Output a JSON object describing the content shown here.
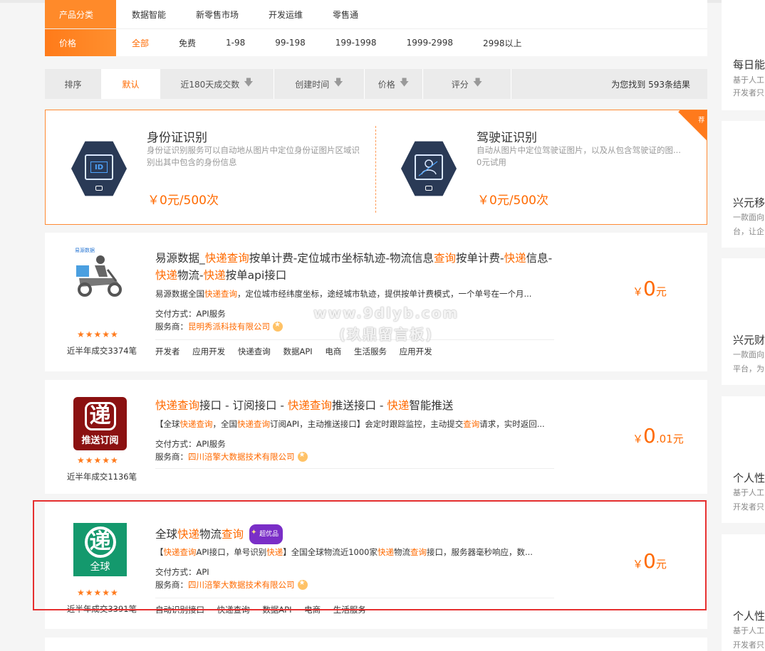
{
  "filter": {
    "category_row": {
      "label": "产品分类",
      "options": [
        "数据智能",
        "新零售市场",
        "开发运维",
        "零售通"
      ]
    },
    "price_row": {
      "label": "价格",
      "options": [
        "全部",
        "免费",
        "1-98",
        "99-198",
        "199-1998",
        "1999-2998",
        "2998以上"
      ]
    }
  },
  "sortbar": {
    "items": [
      "排序",
      "默认",
      "近180天成交数",
      "创建时间",
      "价格",
      "评分"
    ],
    "result_text": "为您找到 593条结果"
  },
  "featured": {
    "corner_label": "荐",
    "items": [
      {
        "title": "身份证识别",
        "desc": "身份证识别服务可以自动地从图片中定位身份证图片区域识别出其中包含的身份信息",
        "price": "￥0元/500次",
        "icon_text": "ID"
      },
      {
        "title": "驾驶证识别",
        "desc": "自动从图片中定位驾驶证图片，以及从包含驾驶证的图...",
        "desc2": "0元试用",
        "price": "￥0元/500次"
      }
    ]
  },
  "products": [
    {
      "title_parts": [
        {
          "t": "易源数据_",
          "hl": false
        },
        {
          "t": "快递查询",
          "hl": true
        },
        {
          "t": "按单计费-定位城市坐标轨迹-物流信息",
          "hl": false
        },
        {
          "t": "查询",
          "hl": true
        },
        {
          "t": "按单计费-",
          "hl": false
        },
        {
          "t": "快递",
          "hl": true
        },
        {
          "t": "信息-",
          "hl": false
        },
        {
          "t": "快递",
          "hl": true
        },
        {
          "t": "物流-",
          "hl": false
        },
        {
          "t": "快递",
          "hl": true
        },
        {
          "t": "按单api接口",
          "hl": false
        }
      ],
      "desc_parts": [
        {
          "t": "易源数据全国",
          "hl": false
        },
        {
          "t": "快递查询",
          "hl": true
        },
        {
          "t": "，定位城市经纬度坐标，途经城市轨迹，提供按单计费模式，一个单号在一个月...",
          "hl": false
        }
      ],
      "delivery": "交付方式：API服务",
      "provider_label": "服务商：",
      "provider": "昆明秀派科技有限公司",
      "stars": "★★★★★",
      "sales": "近半年成交3374笔",
      "tags": [
        "开发者",
        "应用开发",
        "快递查询",
        "数据API",
        "电商",
        "生活服务",
        "应用开发"
      ],
      "price_symbol": "￥",
      "price_main": "0",
      "price_frac": "",
      "price_unit": "元",
      "logo_brand": "易源数据"
    },
    {
      "title_parts": [
        {
          "t": "快递查询",
          "hl": true
        },
        {
          "t": "接口 - 订阅接口 - ",
          "hl": false
        },
        {
          "t": "快递查询",
          "hl": true
        },
        {
          "t": "推送接口 - ",
          "hl": false
        },
        {
          "t": "快递",
          "hl": true
        },
        {
          "t": "智能推送",
          "hl": false
        }
      ],
      "desc_parts": [
        {
          "t": "【全球",
          "hl": false
        },
        {
          "t": "快递查询",
          "hl": true
        },
        {
          "t": "，全国",
          "hl": false
        },
        {
          "t": "快递查询",
          "hl": true
        },
        {
          "t": "订阅API，主动推送接口】会定时跟踪监控，主动提交",
          "hl": false
        },
        {
          "t": "查询",
          "hl": true
        },
        {
          "t": "请求，实时返回...",
          "hl": false
        }
      ],
      "delivery": "交付方式：API服务",
      "provider_label": "服务商：",
      "provider": "四川涪擎大数据技术有限公司",
      "stars": "★★★★★",
      "sales": "近半年成交1136笔",
      "tags": [],
      "price_symbol": "￥",
      "price_main": "0",
      "price_frac": ".01",
      "price_unit": "元",
      "logo_big": "递",
      "logo_small": "推送订阅"
    },
    {
      "title_parts": [
        {
          "t": "全球",
          "hl": false
        },
        {
          "t": "快递",
          "hl": true
        },
        {
          "t": "物流",
          "hl": false
        },
        {
          "t": "查询",
          "hl": true
        }
      ],
      "badge": "超优品",
      "desc_parts": [
        {
          "t": "【",
          "hl": false
        },
        {
          "t": "快递查询",
          "hl": true
        },
        {
          "t": "API接口，单号识别",
          "hl": false
        },
        {
          "t": "快递",
          "hl": true
        },
        {
          "t": "】全国全球物流近1000家",
          "hl": false
        },
        {
          "t": "快递",
          "hl": true
        },
        {
          "t": "物流",
          "hl": false
        },
        {
          "t": "查询",
          "hl": true
        },
        {
          "t": "接口，服务器毫秒响应，数...",
          "hl": false
        }
      ],
      "delivery": "交付方式：API",
      "provider_label": "服务商：",
      "provider": "四川涪擎大数据技术有限公司",
      "stars": "★★★★★",
      "sales": "近半年成交3391笔",
      "tags": [
        "自动识别接口",
        "快递查询",
        "数据API",
        "电商",
        "生活服务"
      ],
      "price_symbol": "￥",
      "price_main": "0",
      "price_frac": "",
      "price_unit": "元",
      "logo_big": "递",
      "logo_small": "全球"
    }
  ],
  "right_column": [
    {
      "title": "每日能",
      "desc1": "基于人工",
      "desc2": "开发者只"
    },
    {
      "title": "兴元移",
      "desc1": "一款面向",
      "desc2": "台，让企"
    },
    {
      "title": "兴元财",
      "desc1": "一款面向",
      "desc2": "平台，为"
    },
    {
      "title": "个人性",
      "desc1": "基于人工",
      "desc2": "开发者只"
    },
    {
      "title": "个人性",
      "desc1": "基于人工",
      "desc2": "开发者只"
    }
  ],
  "watermark": {
    "line1": "www.9dlyb.com",
    "line2": "(玖鼎留言板)"
  }
}
